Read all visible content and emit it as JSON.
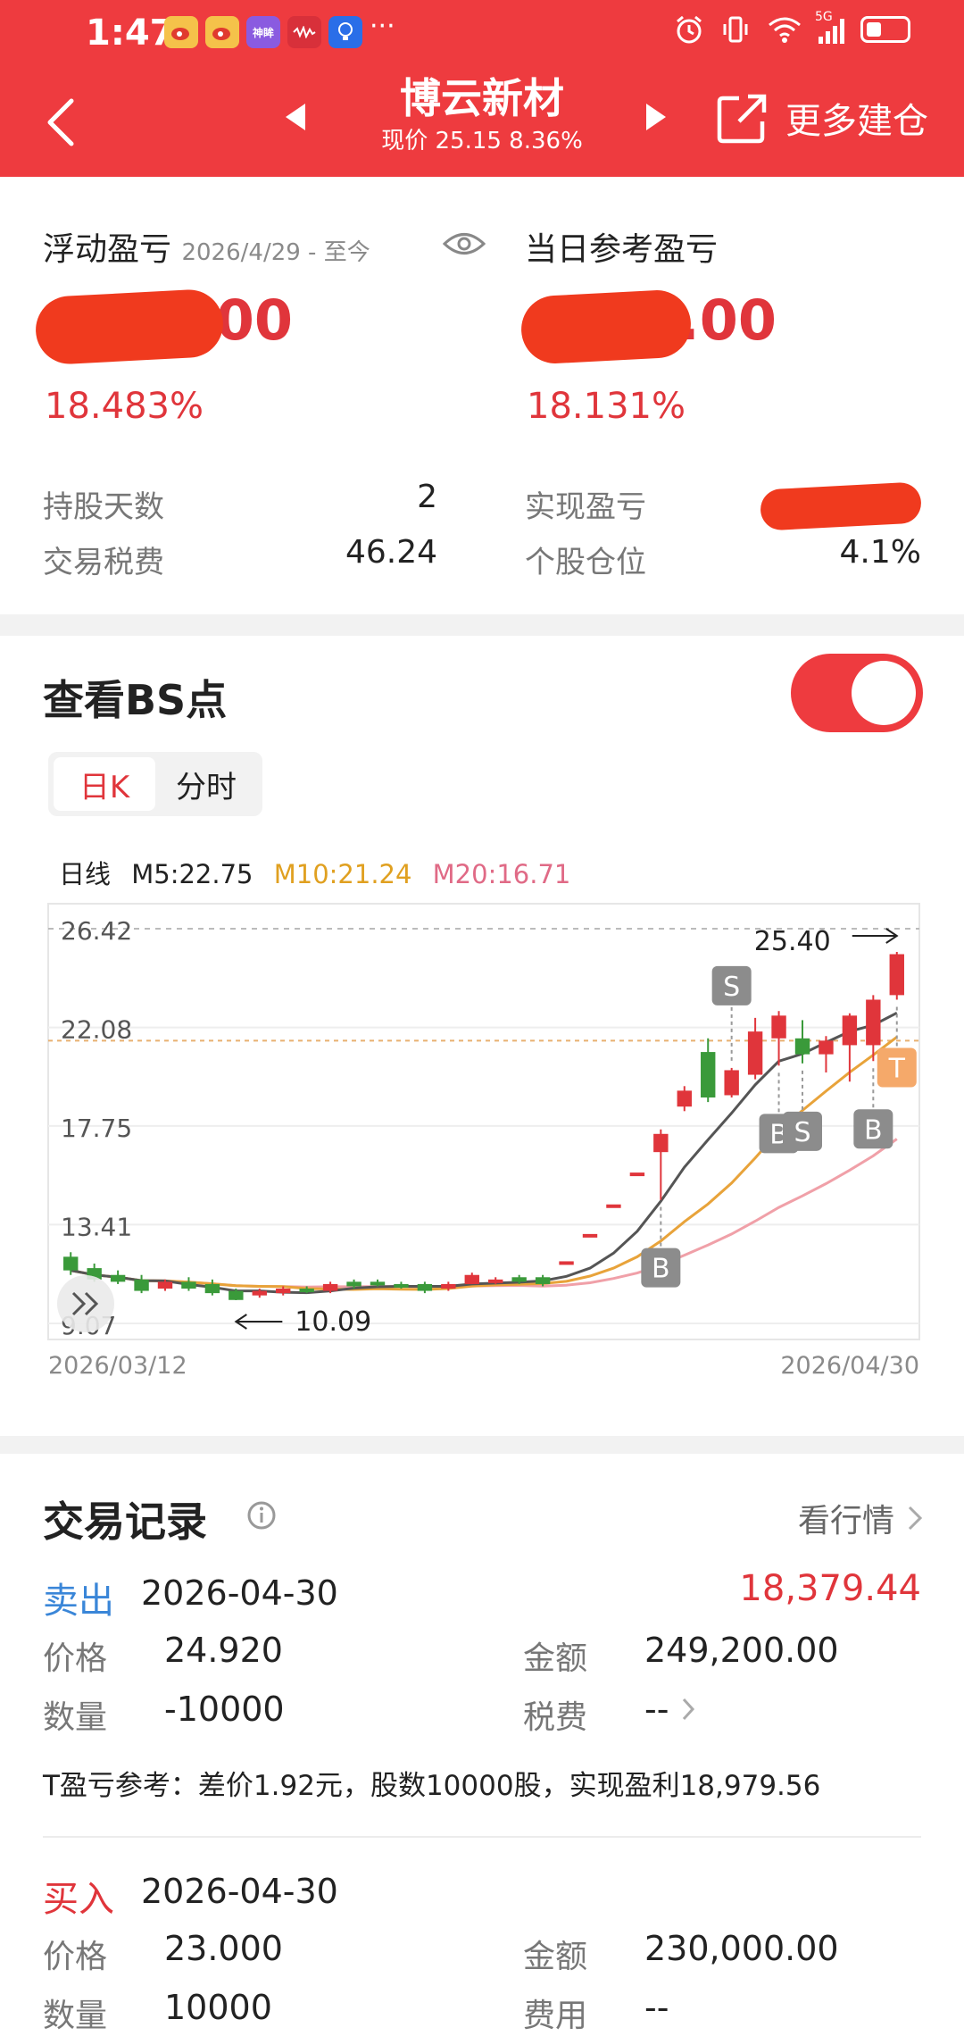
{
  "status_bar": {
    "time": "1:47",
    "apps": [
      "weibo-icon",
      "weibo-icon",
      "shenmeng-icon",
      "mic-app-icon",
      "bulb-app-icon"
    ],
    "app_badge": "神眸",
    "more": "···",
    "network": "5G"
  },
  "header": {
    "title": "博云新材",
    "subtitle": "现价 25.15 8.36%",
    "more_build": "更多建仓",
    "bg_color": "#ee3b3f"
  },
  "summary": {
    "float_label": "浮动盈亏",
    "float_range": "2026/4/29 - 至今",
    "float_value_suffix": ".00",
    "float_pct": "18.483%",
    "daily_label": "当日参考盈亏",
    "daily_value_suffix": "0.00",
    "daily_pct": "18.131%",
    "hold_days_label": "持股天数",
    "hold_days": "2",
    "tax_label": "交易税费",
    "tax": "46.24",
    "realized_label": "实现盈亏",
    "position_label": "个股仓位",
    "position": "4.1%"
  },
  "chart_section": {
    "title": "查看BS点",
    "toggle_on": true,
    "tabs": [
      "日K",
      "分时"
    ],
    "active_tab": "日K",
    "ma_label": "日线",
    "ma5": "M5:22.75",
    "ma10": "M10:21.24",
    "ma20": "M20:16.71",
    "date_start": "2026/03/12",
    "date_end": "2026/04/30"
  },
  "chart_data": {
    "type": "candlestick",
    "y_ticks": [
      "26.42",
      "22.08",
      "17.75",
      "13.41",
      "9.07"
    ],
    "ylim": [
      9.07,
      26.42
    ],
    "max_label": "25.40",
    "min_label": "10.09",
    "ref_price": 21.5,
    "candles": [
      {
        "o": 12.0,
        "c": 11.4,
        "h": 12.2,
        "l": 11.2
      },
      {
        "o": 11.5,
        "c": 11.0,
        "h": 11.7,
        "l": 10.9
      },
      {
        "o": 11.2,
        "c": 10.9,
        "h": 11.4,
        "l": 10.8
      },
      {
        "o": 11.0,
        "c": 10.5,
        "h": 11.2,
        "l": 10.4
      },
      {
        "o": 10.6,
        "c": 10.9,
        "h": 11.0,
        "l": 10.5
      },
      {
        "o": 10.9,
        "c": 10.6,
        "h": 11.1,
        "l": 10.5
      },
      {
        "o": 10.8,
        "c": 10.4,
        "h": 11.0,
        "l": 10.3
      },
      {
        "o": 10.5,
        "c": 10.1,
        "h": 10.6,
        "l": 10.09
      },
      {
        "o": 10.3,
        "c": 10.5,
        "h": 10.6,
        "l": 10.2
      },
      {
        "o": 10.4,
        "c": 10.6,
        "h": 10.7,
        "l": 10.3
      },
      {
        "o": 10.6,
        "c": 10.5,
        "h": 10.7,
        "l": 10.4
      },
      {
        "o": 10.5,
        "c": 10.8,
        "h": 10.9,
        "l": 10.4
      },
      {
        "o": 10.9,
        "c": 10.7,
        "h": 11.0,
        "l": 10.6
      },
      {
        "o": 10.9,
        "c": 10.8,
        "h": 11.0,
        "l": 10.7
      },
      {
        "o": 10.8,
        "c": 10.7,
        "h": 10.9,
        "l": 10.6
      },
      {
        "o": 10.8,
        "c": 10.5,
        "h": 10.9,
        "l": 10.4
      },
      {
        "o": 10.6,
        "c": 10.8,
        "h": 10.9,
        "l": 10.5
      },
      {
        "o": 10.8,
        "c": 11.2,
        "h": 11.3,
        "l": 10.8
      },
      {
        "o": 10.9,
        "c": 11.0,
        "h": 11.1,
        "l": 10.8
      },
      {
        "o": 11.1,
        "c": 10.9,
        "h": 11.2,
        "l": 10.8
      },
      {
        "o": 11.1,
        "c": 10.8,
        "h": 11.2,
        "l": 10.7
      },
      {
        "o": 11.8,
        "c": 11.8,
        "h": 11.8,
        "l": 11.8
      },
      {
        "o": 13.0,
        "c": 13.0,
        "h": 13.0,
        "l": 13.0
      },
      {
        "o": 14.3,
        "c": 14.3,
        "h": 14.3,
        "l": 14.3
      },
      {
        "o": 15.7,
        "c": 15.7,
        "h": 15.7,
        "l": 15.7
      },
      {
        "o": 16.6,
        "c": 17.4,
        "h": 17.6,
        "l": 14.5
      },
      {
        "o": 18.6,
        "c": 19.3,
        "h": 19.5,
        "l": 18.4
      },
      {
        "o": 21.0,
        "c": 19.0,
        "h": 21.6,
        "l": 18.8
      },
      {
        "o": 19.1,
        "c": 20.2,
        "h": 20.3,
        "l": 19.0
      },
      {
        "o": 20.0,
        "c": 21.9,
        "h": 22.5,
        "l": 19.8
      },
      {
        "o": 21.6,
        "c": 22.6,
        "h": 22.8,
        "l": 20.4
      },
      {
        "o": 21.6,
        "c": 20.9,
        "h": 22.4,
        "l": 20.5
      },
      {
        "o": 20.9,
        "c": 21.5,
        "h": 21.7,
        "l": 20.1
      },
      {
        "o": 21.3,
        "c": 22.6,
        "h": 22.7,
        "l": 19.7
      },
      {
        "o": 21.3,
        "c": 23.3,
        "h": 23.5,
        "l": 20.6
      },
      {
        "o": 23.5,
        "c": 25.3,
        "h": 25.4,
        "l": 23.3
      }
    ],
    "markers": [
      {
        "label": "B",
        "index": 25,
        "pos": "below"
      },
      {
        "label": "S",
        "index": 28,
        "pos": "above"
      },
      {
        "label": "B",
        "index": 30,
        "pos": "below"
      },
      {
        "label": "S",
        "index": 31,
        "pos": "below"
      },
      {
        "label": "B",
        "index": 34,
        "pos": "below"
      },
      {
        "label": "T",
        "index": 35,
        "pos": "below"
      }
    ],
    "ma_colors": {
      "m5": "#555555",
      "m10": "#e8a33a",
      "m20": "#f0a0a8"
    }
  },
  "trades": {
    "title": "交易记录",
    "market_link": "看行情",
    "records": [
      {
        "type": "卖出",
        "date": "2026-04-30",
        "profit": "18,379.44",
        "price_label": "价格",
        "price": "24.920",
        "amount_label": "金额",
        "amount": "249,200.00",
        "qty_label": "数量",
        "qty": "-10000",
        "fee_label": "税费",
        "fee": "--",
        "note": "T盈亏参考：差价1.92元，股数10000股，实现盈利18,979.56"
      },
      {
        "type": "买入",
        "date": "2026-04-30",
        "price_label": "价格",
        "price": "23.000",
        "amount_label": "金额",
        "amount": "230,000.00",
        "qty_label": "数量",
        "qty": "10000",
        "fee_label": "费用",
        "fee": "--"
      }
    ]
  },
  "colors": {
    "accent": "#ee3b3f",
    "up": "#e0353b",
    "down": "#3a9a3a",
    "sell": "#3a86d8",
    "buy": "#e0353b"
  }
}
